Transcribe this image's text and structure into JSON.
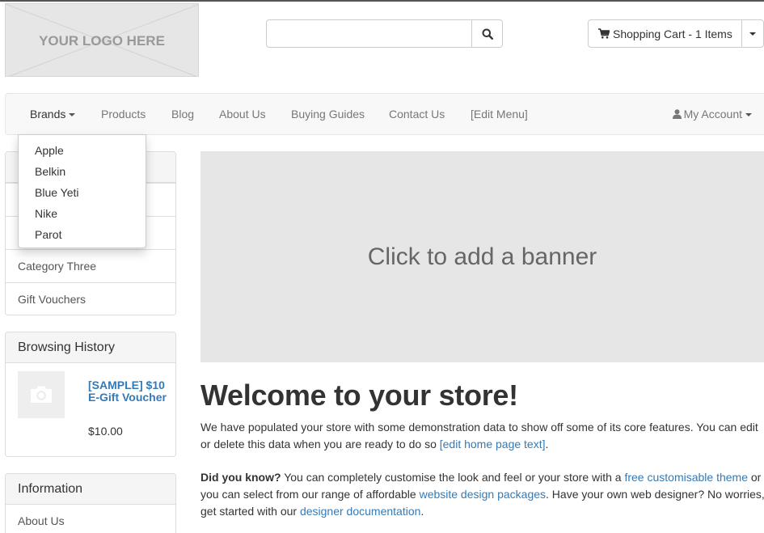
{
  "header": {
    "logo_text": "YOUR LOGO HERE",
    "search": {
      "placeholder": "",
      "value": "",
      "button_icon": "search-icon"
    },
    "cart": {
      "label": "Shopping Cart - 1 Items",
      "icon": "shopping-cart-icon"
    }
  },
  "nav": {
    "items": [
      "Brands",
      "Products",
      "Blog",
      "About Us",
      "Buying Guides",
      "Contact Us",
      "[Edit Menu]"
    ],
    "account_label": "My Account",
    "account_icon": "user-icon"
  },
  "brands_dropdown": {
    "items": [
      "Apple",
      "Belkin",
      "Blue Yeti",
      "Nike",
      "Parot"
    ]
  },
  "categories": {
    "items": [
      "Category Three",
      "Gift Vouchers"
    ]
  },
  "browsing_history": {
    "title": "Browsing History",
    "item": {
      "name": "[SAMPLE] $10 E-Gift Voucher",
      "price": "$10.00"
    }
  },
  "information": {
    "title": "Information",
    "items": [
      "About Us"
    ]
  },
  "main": {
    "banner_text": "Click to add a banner",
    "welcome_title": "Welcome to your store!",
    "intro_text": "We have populated your store with some demonstration data to show off some of its core features. You can edit or delete this data when you are ready to do so",
    "edit_link": "[edit home page text]",
    "intro_end": ".",
    "dyk_label": "Did you know?",
    "dyk_text1": " You can completely customise the look and feel or your store with a ",
    "dyk_link1": "free customisable theme",
    "dyk_text2": " or you can select from our range of affordable ",
    "dyk_link2": "website design packages",
    "dyk_text3": ". Have your own web designer? No worries, get started with our ",
    "dyk_link3": "designer documentation",
    "dyk_text4": "."
  },
  "colors": {
    "link": "#337ab7",
    "panel_head": "#f5f5f5",
    "banner": "#e6e6e6"
  }
}
